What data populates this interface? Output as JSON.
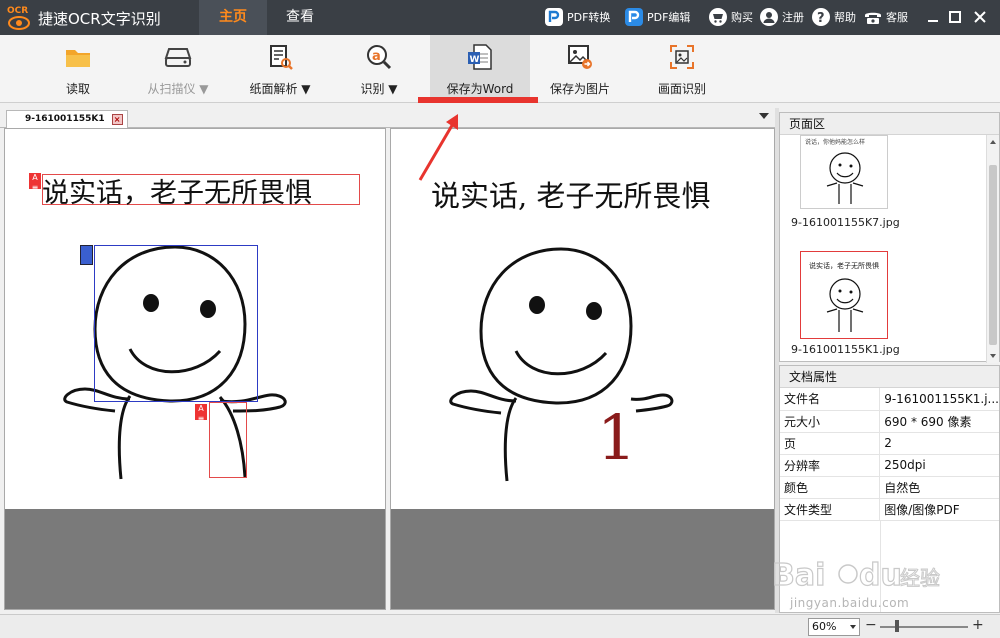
{
  "app": {
    "title": "捷速OCR文字识别",
    "logo_text": "OCR",
    "accent": "#ff8a1c",
    "titlebar_bg": "#3a3f45"
  },
  "menu": {
    "tabs": [
      {
        "label": "主页",
        "active": true
      },
      {
        "label": "查看",
        "active": false
      }
    ]
  },
  "title_links": [
    {
      "label": "PDF转换",
      "icon": "pdf-convert-icon"
    },
    {
      "label": "PDF编辑",
      "icon": "pdf-edit-icon"
    },
    {
      "label": "购买",
      "icon": "cart-icon"
    },
    {
      "label": "注册",
      "icon": "user-icon"
    },
    {
      "label": "帮助",
      "icon": "help-icon"
    },
    {
      "label": "客服",
      "icon": "phone-icon"
    }
  ],
  "toolbar": {
    "items": [
      {
        "label": "读取",
        "icon": "folder-icon",
        "dropdown": false,
        "disabled": false
      },
      {
        "label": "从扫描仪 ▼",
        "icon": "scanner-icon",
        "dropdown": true,
        "disabled": true
      },
      {
        "label": "纸面解析 ▼",
        "icon": "page-analyze-icon",
        "dropdown": true,
        "disabled": false
      },
      {
        "label": "识别 ▼",
        "icon": "recognize-icon",
        "dropdown": true,
        "disabled": false
      },
      {
        "label": "保存为Word",
        "icon": "word-icon",
        "dropdown": false,
        "disabled": false,
        "active": true
      },
      {
        "label": "保存为图片",
        "icon": "image-save-icon",
        "dropdown": false,
        "disabled": false
      },
      {
        "label": "画面识别",
        "icon": "screen-recognize-icon",
        "dropdown": false,
        "disabled": false
      }
    ]
  },
  "document": {
    "tab_name": "9-161001155K1",
    "left_text": "说实话，老子无所畏惧",
    "right_text": "说实话, 老子无所畏惧",
    "right_digit": "1"
  },
  "page_area": {
    "header": "页面区",
    "thumbnails": [
      {
        "caption": "9-161001155K7.jpg",
        "selected": false,
        "thumb_text": "说话，你他妈能怎么样"
      },
      {
        "caption": "9-161001155K1.jpg",
        "selected": true,
        "thumb_text": "说实话，老子无所畏惧"
      }
    ]
  },
  "doc_props": {
    "header": "文档属性",
    "rows": [
      {
        "key": "文件名",
        "value": "9-161001155K1.j..."
      },
      {
        "key": "元大小",
        "value": "690 * 690 像素"
      },
      {
        "key": "页",
        "value": "2"
      },
      {
        "key": "分辨率",
        "value": "250dpi"
      },
      {
        "key": "颜色",
        "value": "自然色"
      },
      {
        "key": "文件类型",
        "value": "图像/图像PDF"
      }
    ]
  },
  "status": {
    "zoom": "60%",
    "minus": "−",
    "plus": "+"
  },
  "watermark": {
    "text": "jingyan.baidu.com"
  }
}
